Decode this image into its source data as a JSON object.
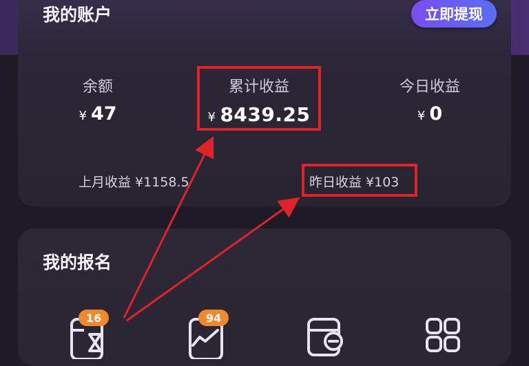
{
  "account": {
    "title": "我的账户",
    "withdraw_label": "立即提现",
    "balance": {
      "label": "余额",
      "currency": "¥",
      "value": "47"
    },
    "total_earnings": {
      "label": "累计收益",
      "currency": "¥",
      "value": "8439.25"
    },
    "today_earnings": {
      "label": "今日收益",
      "currency": "¥",
      "value": "0"
    },
    "last_month": "上月收益 ¥1158.5",
    "yesterday": "昨日收益 ¥103"
  },
  "signup": {
    "title": "我的报名",
    "items": [
      {
        "icon": "hourglass-card-icon",
        "badge": "16"
      },
      {
        "icon": "chart-card-icon",
        "badge": "94"
      },
      {
        "icon": "card-minus-icon",
        "badge": ""
      },
      {
        "icon": "grid-apps-icon",
        "badge": ""
      }
    ]
  },
  "colors": {
    "highlight": "#e0232b",
    "badge": "#f0892a",
    "button_gradient_start": "#7a4cf0",
    "button_gradient_end": "#5a6ef2"
  }
}
